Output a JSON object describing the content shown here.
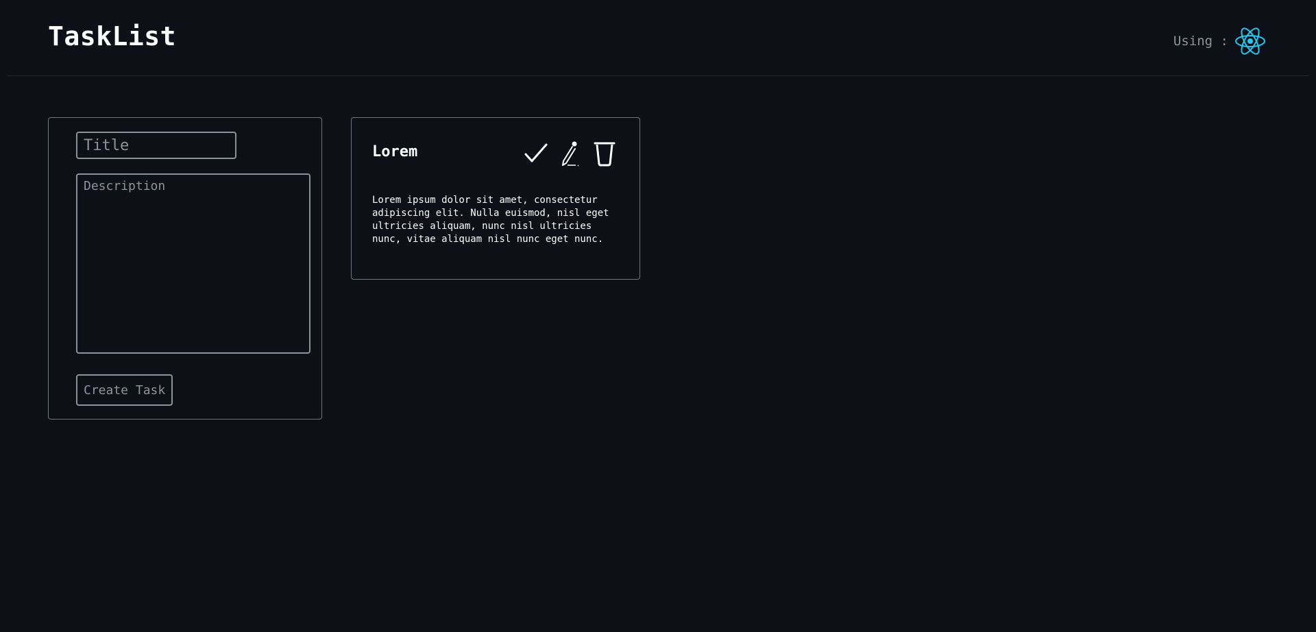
{
  "header": {
    "app_title": "TaskList",
    "using_label": "Using :",
    "tech_icon": "react-logo-icon"
  },
  "form": {
    "title_placeholder": "Title",
    "description_placeholder": "Description",
    "create_button_label": "Create Task"
  },
  "tasks": [
    {
      "title": "Lorem",
      "description": "Lorem ipsum dolor sit amet, consectetur adipiscing elit. Nulla euismod, nisl eget ultricies aliquam, nunc nisl ultricies nunc, vitae aliquam nisl nunc eget nunc.",
      "actions": [
        "check-icon",
        "pencil-icon",
        "trash-icon"
      ]
    }
  ],
  "colors": {
    "background": "#0d1117",
    "border": "#6e7681",
    "input_border": "#8b949e",
    "muted_text": "#8b949e",
    "react_accent": "#22c7f0"
  }
}
